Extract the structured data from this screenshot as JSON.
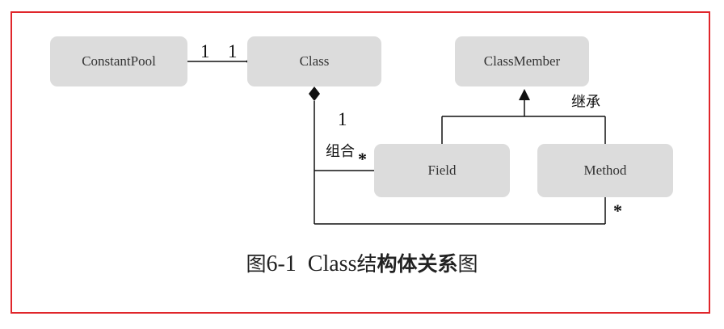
{
  "boxes": {
    "constant_pool": "ConstantPool",
    "class": "Class",
    "class_member": "ClassMember",
    "field": "Field",
    "method": "Method"
  },
  "multiplicities": {
    "pool_side": "1",
    "class_side": "1",
    "class_below": "1",
    "field_star": "*",
    "method_star": "*"
  },
  "relations": {
    "composition": "组合",
    "inheritance": "继承"
  },
  "caption": {
    "prefix": "图6-1",
    "latin": "Class",
    "cjk_part1": "结",
    "cjk_bold": "构体关系",
    "cjk_part2": "图"
  },
  "colors": {
    "frame_border": "#e0262b",
    "box_fill": "#dcdcdc"
  }
}
